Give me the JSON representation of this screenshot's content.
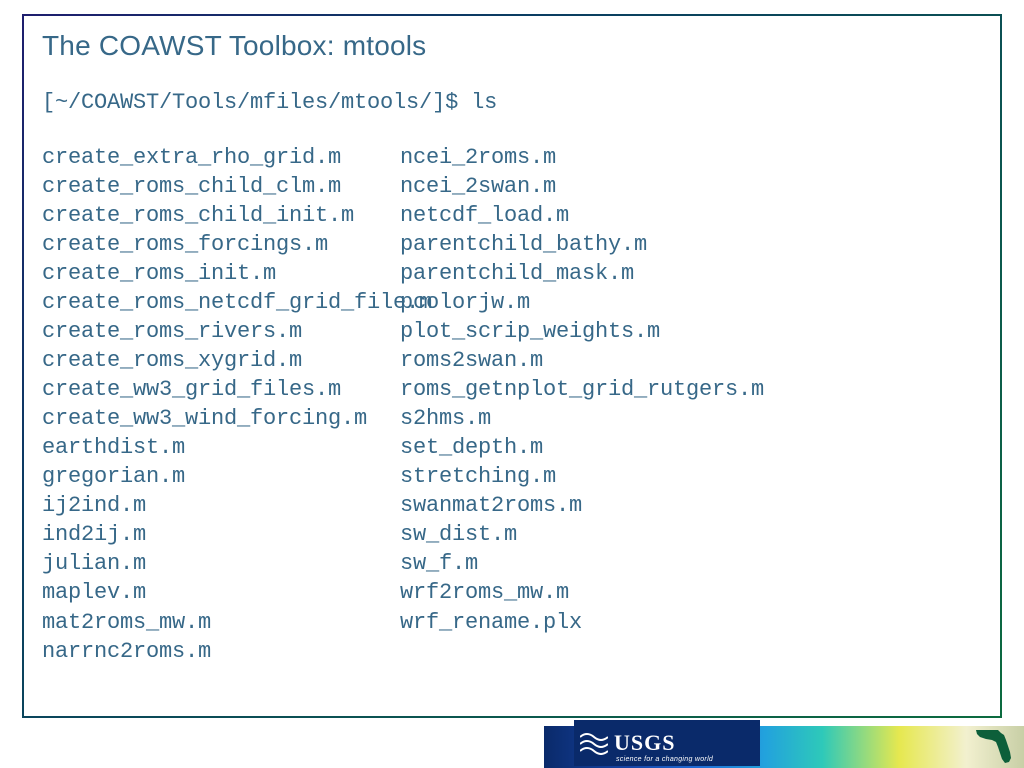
{
  "title": "The COAWST Toolbox: mtools",
  "prompt": "[~/COAWST/Tools/mfiles/mtools/]$ ls",
  "listing": {
    "left": [
      "create_extra_rho_grid.m",
      "create_roms_child_clm.m",
      "create_roms_child_init.m",
      "create_roms_forcings.m",
      "create_roms_init.m",
      "create_roms_netcdf_grid_file.m",
      "create_roms_rivers.m",
      "create_roms_xygrid.m",
      "create_ww3_grid_files.m",
      "create_ww3_wind_forcing.m",
      "earthdist.m",
      "gregorian.m",
      "ij2ind.m",
      "ind2ij.m",
      "julian.m",
      "maplev.m",
      "mat2roms_mw.m",
      "narrnc2roms.m"
    ],
    "right": [
      "ncei_2roms.m",
      "ncei_2swan.m",
      "netcdf_load.m",
      "parentchild_bathy.m",
      "parentchild_mask.m",
      "pcolorjw.m",
      "plot_scrip_weights.m",
      "roms2swan.m",
      "roms_getnplot_grid_rutgers.m",
      "s2hms.m",
      "set_depth.m",
      "stretching.m",
      "swanmat2roms.m",
      "sw_dist.m",
      "sw_f.m",
      "wrf2roms_mw.m",
      "wrf_rename.plx"
    ]
  },
  "footer": {
    "usgs_label": "USGS",
    "usgs_tagline": "science for a changing world"
  }
}
